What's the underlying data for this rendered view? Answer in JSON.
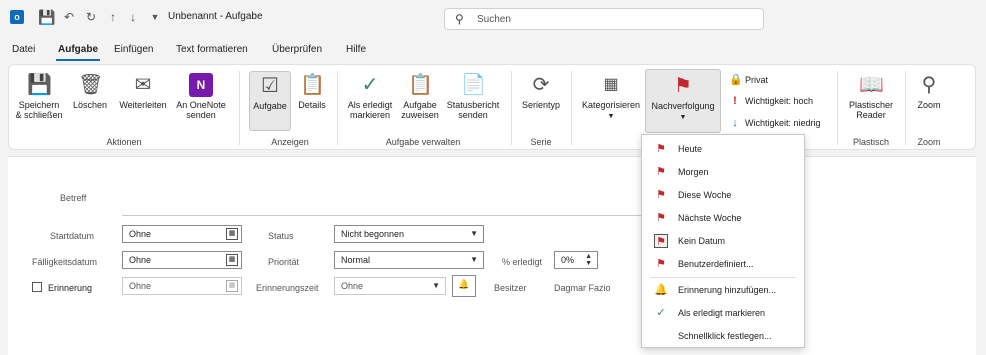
{
  "titlebar": {
    "app_icon": "outlook-icon",
    "title": "Unbenannt  -  Aufgabe",
    "search_placeholder": "Suchen"
  },
  "menu": {
    "tabs": [
      "Datei",
      "Aufgabe",
      "Einfügen",
      "Text formatieren",
      "Überprüfen",
      "Hilfe"
    ],
    "active": "Aufgabe"
  },
  "ribbon": {
    "save_close": [
      "Speichern",
      "& schließen"
    ],
    "delete": "Löschen",
    "forward": "Weiterleiten",
    "onenote": [
      "An OneNote",
      "senden"
    ],
    "group_actions": "Aktionen",
    "task": "Aufgabe",
    "details": "Details",
    "group_show": "Anzeigen",
    "mark_complete": [
      "Als erledigt",
      "markieren"
    ],
    "assign": [
      "Aufgabe",
      "zuweisen"
    ],
    "status_report": [
      "Statusbericht",
      "senden"
    ],
    "group_manage": "Aufgabe verwalten",
    "recurrence": "Serientyp",
    "group_series": "Serie",
    "categorize": "Kategorisieren",
    "follow_up": "Nachverfolgung",
    "private": "Privat",
    "high_importance": "Wichtigkeit: hoch",
    "low_importance": "Wichtigkeit: niedrig",
    "immersive_reader": [
      "Plastischer",
      "Reader"
    ],
    "group_immersive": "Plastisch",
    "zoom": "Zoom",
    "group_zoom": "Zoom"
  },
  "form": {
    "subject_label": "Betreff",
    "start_label": "Startdatum",
    "start_value": "Ohne",
    "due_label": "Fälligkeitsdatum",
    "due_value": "Ohne",
    "reminder_label": "Erinnerung",
    "reminder_value": "Ohne",
    "status_label": "Status",
    "status_value": "Nicht begonnen",
    "priority_label": "Priorität",
    "priority_value": "Normal",
    "reminder_time_label": "Erinnerungszeit",
    "reminder_time_value": "Ohne",
    "percent_label": "% erledigt",
    "percent_value": "0%",
    "owner_label": "Besitzer",
    "owner_value": "Dagmar Fazio"
  },
  "followup_menu": {
    "items": [
      "Heute",
      "Morgen",
      "Diese Woche",
      "Nächste Woche",
      "Kein Datum",
      "Benutzerdefiniert...",
      "Erinnerung hinzufügen...",
      "Als erledigt markieren",
      "Schnellklick festlegen..."
    ]
  },
  "colors": {
    "accent": "#0f6cbd",
    "flag": "#c4262e",
    "check": "#2e8b57"
  }
}
